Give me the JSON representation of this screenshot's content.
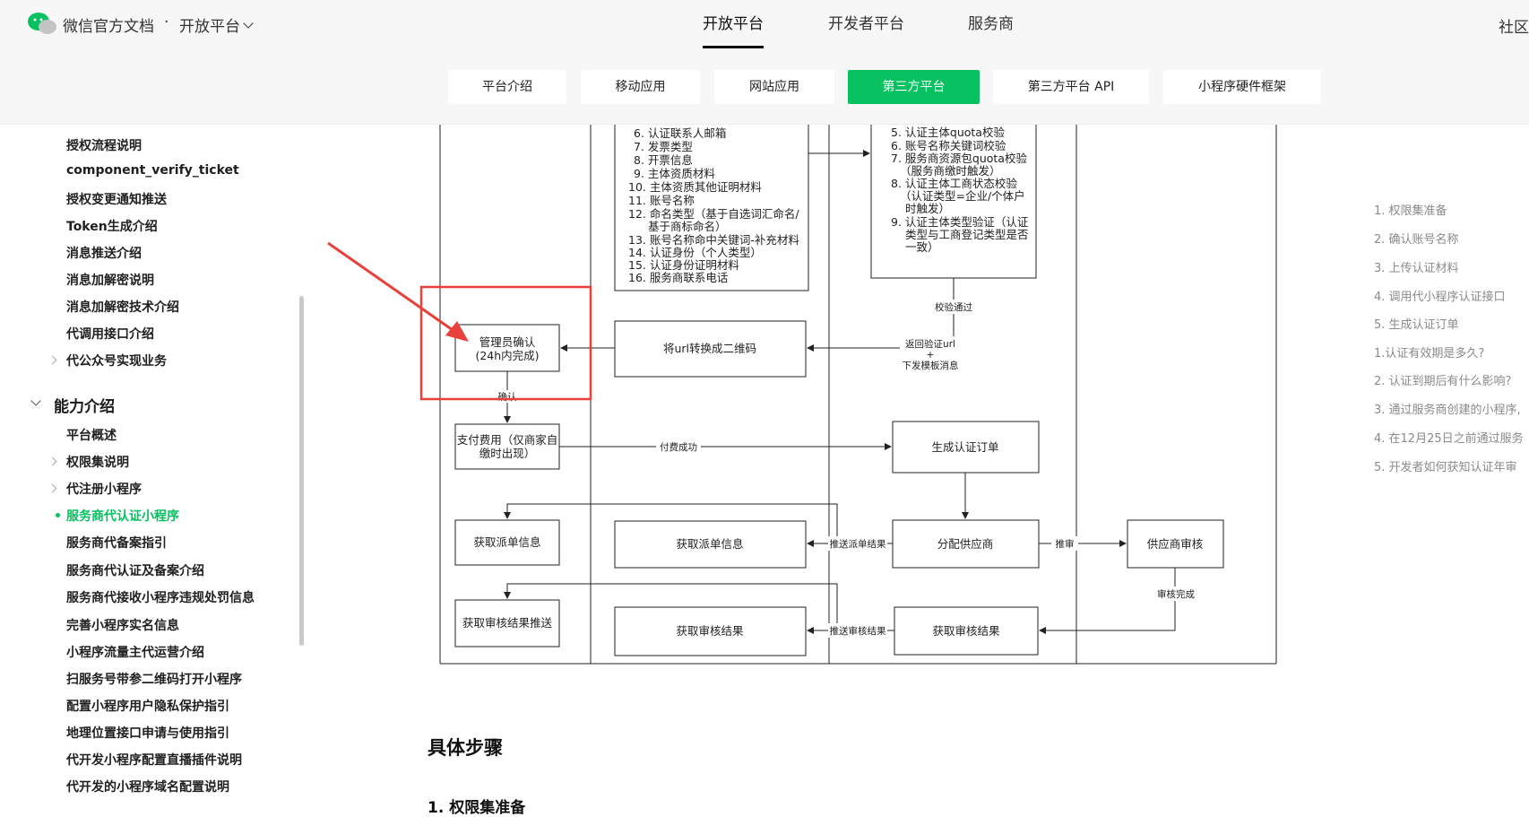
{
  "header": {
    "brand": "微信官方文档",
    "separator": "·",
    "platform": "开放平台",
    "nav": [
      "开放平台",
      "开发者平台",
      "服务商"
    ],
    "community": "社区"
  },
  "subnav": {
    "tabs": [
      "平台介绍",
      "移动应用",
      "网站应用",
      "第三方平台",
      "第三方平台 API",
      "小程序硬件框架"
    ],
    "active": "第三方平台"
  },
  "sidebar": {
    "items_top": [
      "授权流程说明",
      "component_verify_ticket",
      "授权变更通知推送",
      "Token生成介绍",
      "消息推送介绍",
      "消息加解密说明",
      "消息加解密技术介绍",
      "代调用接口介绍",
      "代公众号实现业务"
    ],
    "section": "能力介绍",
    "items": [
      "平台概述",
      "权限集说明",
      "代注册小程序",
      "服务商代认证小程序",
      "服务商代备案指引",
      "服务商代认证及备案介绍",
      "服务商代接收小程序违规处罚信息",
      "完善小程序实名信息",
      "小程序流量主代运营介绍",
      "扫服务号带参二维码打开小程序",
      "配置小程序用户隐私保护指引",
      "地理位置接口申请与使用指引",
      "代开发小程序配置直播插件说明",
      "代开发的小程序域名配置说明"
    ],
    "active": "服务商代认证小程序"
  },
  "diagram": {
    "list_left": [
      "6. 认证联系人邮箱",
      "7. 发票类型",
      "8. 开票信息",
      "9. 主体资质材料",
      "10. 主体资质其他证明材料",
      "11. 账号名称",
      "12. 命名类型（基于自选词汇命名/",
      "基于商标命名）",
      "13. 账号名称命中关键词-补充材料",
      "14. 认证身份（个人类型）",
      "15. 认证身份证明材料",
      "16. 服务商联系电话"
    ],
    "list_right": [
      "5. 认证主体quota校验",
      "6. 账号名称关键词校验",
      "7. 服务商资源包quota校验",
      "（服务商缴时触发）",
      "8. 认证主体工商状态校验",
      "（认证类型=企业/个体户",
      "时触发）",
      "9. 认证主体类型验证（认证",
      "类型与工商登记类型是否",
      "一致）"
    ],
    "admin_confirm_1": "管理员确认",
    "admin_confirm_2": "(24h内完成)",
    "qr_convert": "将url转换成二维码",
    "verify_passed": "校验通过",
    "return_url": "返回验证url",
    "plus": "+",
    "send_template": "下发模板消息",
    "confirm": "确认",
    "pay_1": "支付费用（仅商家自",
    "pay_2": "缴时出现）",
    "pay_success": "付费成功",
    "gen_order": "生成认证订单",
    "get_dispatch_left": "获取派单信息",
    "get_dispatch_mid": "获取派单信息",
    "push_dispatch": "推送派单结果",
    "assign_supplier": "分配供应商",
    "push_review": "推审",
    "supplier_review": "供应商审核",
    "review_done": "审核完成",
    "get_result_push": "获取审核结果推送",
    "get_result_mid": "获取审核结果",
    "push_result": "推送审核结果",
    "get_result_right": "获取审核结果"
  },
  "content": {
    "steps_title": "具体步骤",
    "step1": "1. 权限集准备"
  },
  "toc": [
    "1. 权限集准备",
    "2. 确认账号名称",
    "3. 上传认证材料",
    "4. 调用代小程序认证接口",
    "5. 生成认证订单",
    "1.认证有效期是多久?",
    "2. 认证到期后有什么影响?",
    "3. 通过服务商创建的小程序,",
    "4. 在12月25日之前通过服务",
    "5. 开发者如何获知认证年审"
  ],
  "colors": {
    "accent": "#07c160",
    "highlight_red": "#e8403a",
    "toc_text": "#8a8a8a"
  }
}
